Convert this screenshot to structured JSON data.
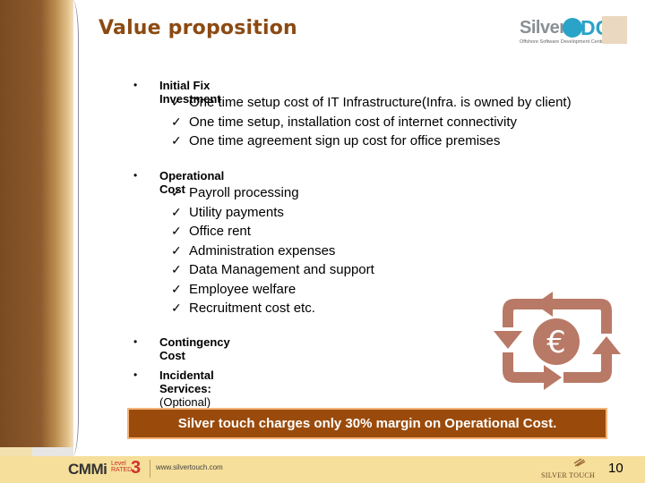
{
  "slide": {
    "title": "Value proposition",
    "page_number": "10"
  },
  "logo": {
    "name_part1": "Silver",
    "name_part2": "DC",
    "tagline": "Offshore Software Development Centre"
  },
  "sections": [
    {
      "label": "Initial Fix Investment",
      "bullet": "•",
      "items": [
        "One time setup cost of IT Infrastructure(Infra. is owned by client)",
        "One time setup, installation cost of internet connectivity",
        "One time agreement sign up cost for office premises"
      ]
    },
    {
      "label": "Operational Cost",
      "bullet": "•",
      "items": [
        "Payroll processing",
        "Utility payments",
        "Office rent",
        "Administration expenses",
        "Data Management and support",
        "Employee welfare",
        "Recruitment cost etc."
      ]
    },
    {
      "label": "Contingency Cost",
      "bullet": "•"
    },
    {
      "label": "Incidental Services:",
      "label_suffix": " (Optional)",
      "bullet": "•"
    }
  ],
  "check_glyph": "✓",
  "icon": {
    "name": "euro-cycle-icon",
    "symbol": "€"
  },
  "banner": {
    "text": "Silver touch charges only 30% margin on Operational Cost."
  },
  "footer": {
    "cmmi": "CMMi",
    "cmmi_level": "Level",
    "cmmi_rated": "RATED",
    "cmmi_number": "3",
    "url": "www.silvertouch.com",
    "company": "SILVER TOUCH"
  },
  "colors": {
    "title": "#8c4a12",
    "banner_bg": "#9a4b0c",
    "banner_border": "#f4b37a",
    "icon": "#b26e5a",
    "footer_bg": "#f6df9a"
  }
}
